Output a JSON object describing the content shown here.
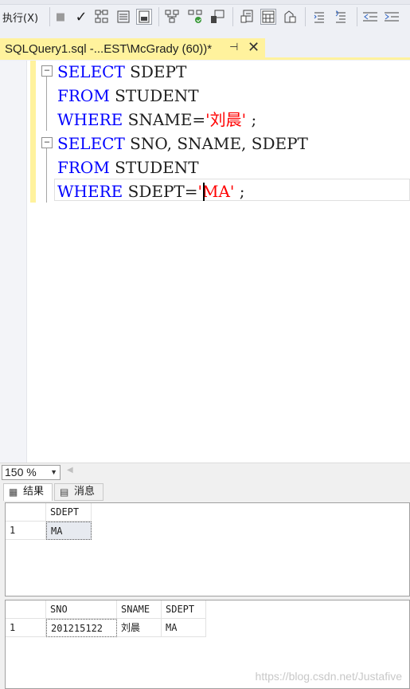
{
  "toolbar": {
    "execute_label": "执行(X)",
    "icons": [
      "stop-icon",
      "checkmark-icon",
      "parse-icon",
      "results-to-text-icon",
      "results-to-grid-icon",
      "plan-icon",
      "live-stats-icon",
      "include-client-stats-icon",
      "query-options-icon",
      "display-plan-icon",
      "comment-icon",
      "uncomment-icon",
      "decrease-indent-icon",
      "increase-indent-icon"
    ]
  },
  "tab": {
    "title": "SQLQuery1.sql -...EST\\McGrady (60))*",
    "pin_glyph": "⊣",
    "close_glyph": "✕"
  },
  "editor": {
    "lines": [
      {
        "kw1": "SELECT",
        "rest": " SDEPT"
      },
      {
        "kw1": "FROM",
        "rest": " STUDENT"
      },
      {
        "kw1": "WHERE",
        "pre": " SNAME=",
        "str": "'刘晨'",
        "post": " ;"
      },
      {
        "kw1": "SELECT",
        "rest": " SNO, SNAME, SDEPT"
      },
      {
        "kw1": "FROM",
        "rest": " STUDENT"
      },
      {
        "kw1": "WHERE",
        "pre": " SDEPT=",
        "str": "'MA'",
        "post": " ;"
      }
    ]
  },
  "zoom": {
    "value": "150 %"
  },
  "results_tabs": {
    "results": "结果",
    "messages": "消息"
  },
  "grid1": {
    "columns": [
      "SDEPT"
    ],
    "rows": [
      {
        "num": "1",
        "cells": [
          "MA"
        ]
      }
    ]
  },
  "grid2": {
    "columns": [
      "SNO",
      "SNAME",
      "SDEPT"
    ],
    "rows": [
      {
        "num": "1",
        "cells": [
          "201215122",
          "刘晨",
          "MA"
        ]
      }
    ]
  },
  "watermark": "https://blog.csdn.net/Justafive"
}
